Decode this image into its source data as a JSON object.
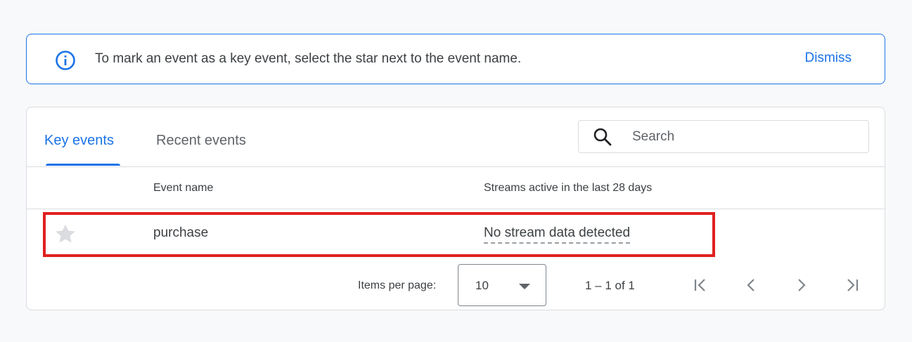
{
  "banner": {
    "message": "To mark an event as a key event, select the star next to the event name.",
    "dismiss_label": "Dismiss",
    "icon": "info-icon"
  },
  "tabs": [
    {
      "label": "Key events",
      "active": true
    },
    {
      "label": "Recent events",
      "active": false
    }
  ],
  "search": {
    "placeholder": "Search",
    "value": ""
  },
  "table": {
    "columns": [
      "Event name",
      "Streams active in the last 28 days"
    ],
    "rows": [
      {
        "key_event": false,
        "name": "purchase",
        "streams": "No stream data detected"
      }
    ]
  },
  "pagination": {
    "items_per_page_label": "Items per page:",
    "items_per_page_value": "10",
    "range_label": "1 – 1 of 1"
  },
  "colors": {
    "accent": "#1a73e8",
    "highlight": "#e02020",
    "star_inactive": "#dadce0"
  }
}
